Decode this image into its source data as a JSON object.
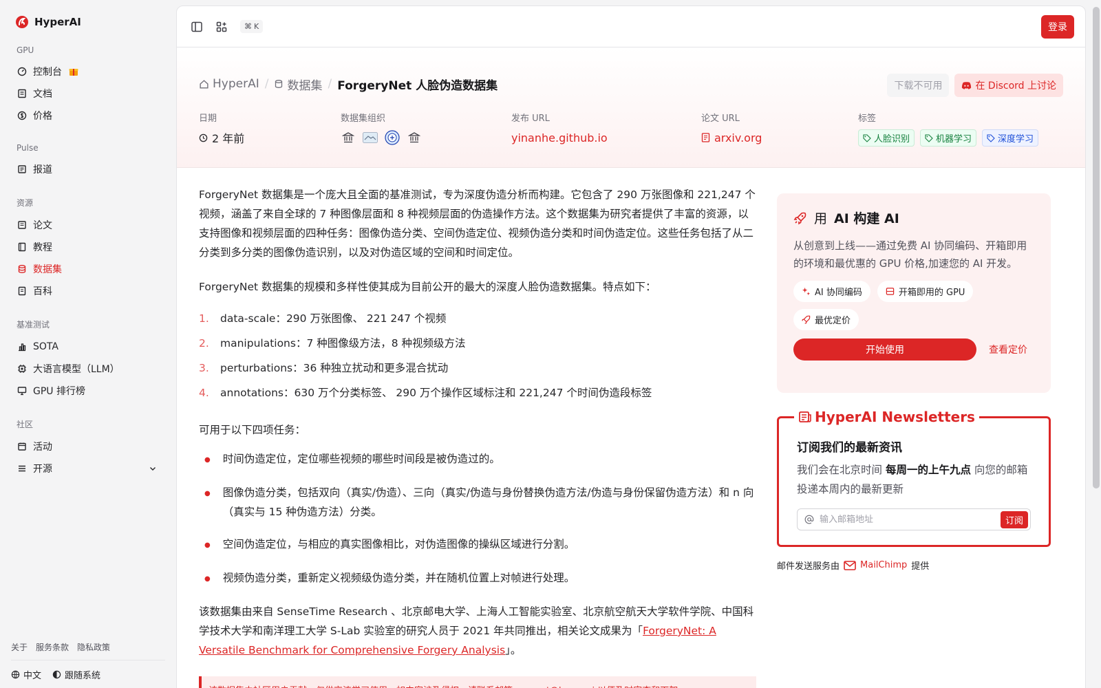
{
  "brand": {
    "name": "HyperAI"
  },
  "sidebar": {
    "sections": [
      {
        "title": "GPU",
        "items": [
          {
            "label": "控制台",
            "icon": "gauge-icon",
            "badge": "gift-icon"
          },
          {
            "label": "文档",
            "icon": "book-icon"
          },
          {
            "label": "价格",
            "icon": "dollar-icon"
          }
        ]
      },
      {
        "title": "Pulse",
        "items": [
          {
            "label": "报道",
            "icon": "newspaper-icon"
          }
        ]
      },
      {
        "title": "资源",
        "items": [
          {
            "label": "论文",
            "icon": "document-icon"
          },
          {
            "label": "教程",
            "icon": "notebook-icon"
          },
          {
            "label": "数据集",
            "icon": "database-icon",
            "active": true
          },
          {
            "label": "百科",
            "icon": "encyclopedia-icon"
          }
        ]
      },
      {
        "title": "基准测试",
        "items": [
          {
            "label": "SOTA",
            "icon": "bar-chart-icon"
          },
          {
            "label": "大语言模型（LLM）",
            "icon": "chip-icon"
          },
          {
            "label": "GPU 排行榜",
            "icon": "monitor-icon"
          }
        ]
      },
      {
        "title": "社区",
        "items": [
          {
            "label": "活动",
            "icon": "calendar-icon"
          },
          {
            "label": "开源",
            "icon": "list-icon",
            "expandable": true
          }
        ]
      }
    ],
    "footer_links": [
      "关于",
      "服务条款",
      "隐私政策"
    ],
    "language": "中文",
    "theme": "跟随系统"
  },
  "topbar": {
    "shortcut": "K",
    "login": "登录"
  },
  "hero": {
    "breadcrumb": {
      "home": "HyperAI",
      "section": "数据集",
      "current": "ForgeryNet 人脸伪造数据集"
    },
    "download": "下载不可用",
    "discord": "在 Discord 上讨论",
    "meta": {
      "date_label": "日期",
      "date_value": "2 年前",
      "org_label": "数据集组织",
      "url_label": "发布 URL",
      "url_value": "yinanhe.github.io",
      "paper_label": "论文 URL",
      "paper_value": "arxiv.org",
      "tags_label": "标签",
      "tags": [
        "人脸识别",
        "机器学习",
        "深度学习"
      ]
    }
  },
  "content": {
    "intro": "ForgeryNet 数据集是一个庞大且全面的基准测试，专为深度伪造分析而构建。它包含了 290 万张图像和 221,247 个视频，涵盖了来自全球的 7 种图像层面和 8 种视频层面的伪造操作方法。这个数据集为研究者提供了丰富的资源，以支持图像和视频层面的四种任务：图像伪造分类、空间伪造定位、视频伪造分类和时间伪造定位。这些任务包括了从二分类到多分类的图像伪造识别，以及对伪造区域的空间和时间定位。",
    "features_intro": "ForgeryNet 数据集的规模和多样性使其成为目前公开的最大的深度人脸伪造数据集。特点如下：",
    "features": [
      {
        "num": "1.",
        "text": "data-scale：290 万张图像、 221 247 个视频"
      },
      {
        "num": "2.",
        "text": "manipulations：7 种图像级方法，8 种视频级方法"
      },
      {
        "num": "3.",
        "text": "perturbations：36 种独立扰动和更多混合扰动"
      },
      {
        "num": "4.",
        "text": "annotations：630 万个分类标签、 290 万个操作区域标注和 221,247 个时间伪造段标签"
      }
    ],
    "tasks_intro": "可用于以下四项任务：",
    "tasks": [
      "时间伪造定位，定位哪些视频的哪些时间段是被伪造过的。",
      "图像伪造分类，包括双向（真实/伪造）、三向（真实/伪造与身份替换伪造方法/伪造与身份保留伪造方法）和 n 向（真实与 15 种伪造方法）分类。",
      "空间伪造定位，与相应的真实图像相比，对伪造图像的操纵区域进行分割。",
      "视频伪造分类，重新定义视频级伪造分类，并在随机位置上对帧进行处理。"
    ],
    "credit_before": "该数据集由来自 SenseTime Research 、北京邮电大学、上海人工智能实验室、北京航空航天大学软件学院、中国科学技术大学和南洋理工大学 S-Lab 实验室的研究人员于 2021 年共同推出，相关论文成果为「",
    "credit_link": "ForgeryNet: A Versatile Benchmark for Comprehensive Forgery Analysis",
    "credit_after": "」。",
    "notice": "该数据集由社区用户贡献，仅供交流学习使用，如内容涉及侵权，请联系邮箱 support@hyper.ai 以便及时审查和下架。"
  },
  "ai_card": {
    "title_prefix": "用",
    "title_bold": "AI 构建 AI",
    "desc": "从创意到上线——通过免费 AI 协同编码、开箱即用的环境和最优惠的 GPU 价格,加速您的 AI 开发。",
    "chips": [
      "AI 协同编码",
      "开箱即用的 GPU",
      "最优定价"
    ],
    "start": "开始使用",
    "pricing": "查看定价"
  },
  "newsletter": {
    "legend": "HyperAI Newsletters",
    "heading": "订阅我们的最新资讯",
    "p_before": "我们会在北京时间 ",
    "p_bold": "每周一的上午九点",
    "p_after": " 向您的邮箱投递本周内的最新更新",
    "placeholder": "输入邮箱地址",
    "subscribe": "订阅"
  },
  "mailchimp": {
    "before": "邮件发送服务由",
    "name": "MailChimp",
    "after": "提供"
  },
  "colors": {
    "accent": "#dc2626",
    "tag_green": "#15803d",
    "tag_blue": "#1d4ed8"
  }
}
